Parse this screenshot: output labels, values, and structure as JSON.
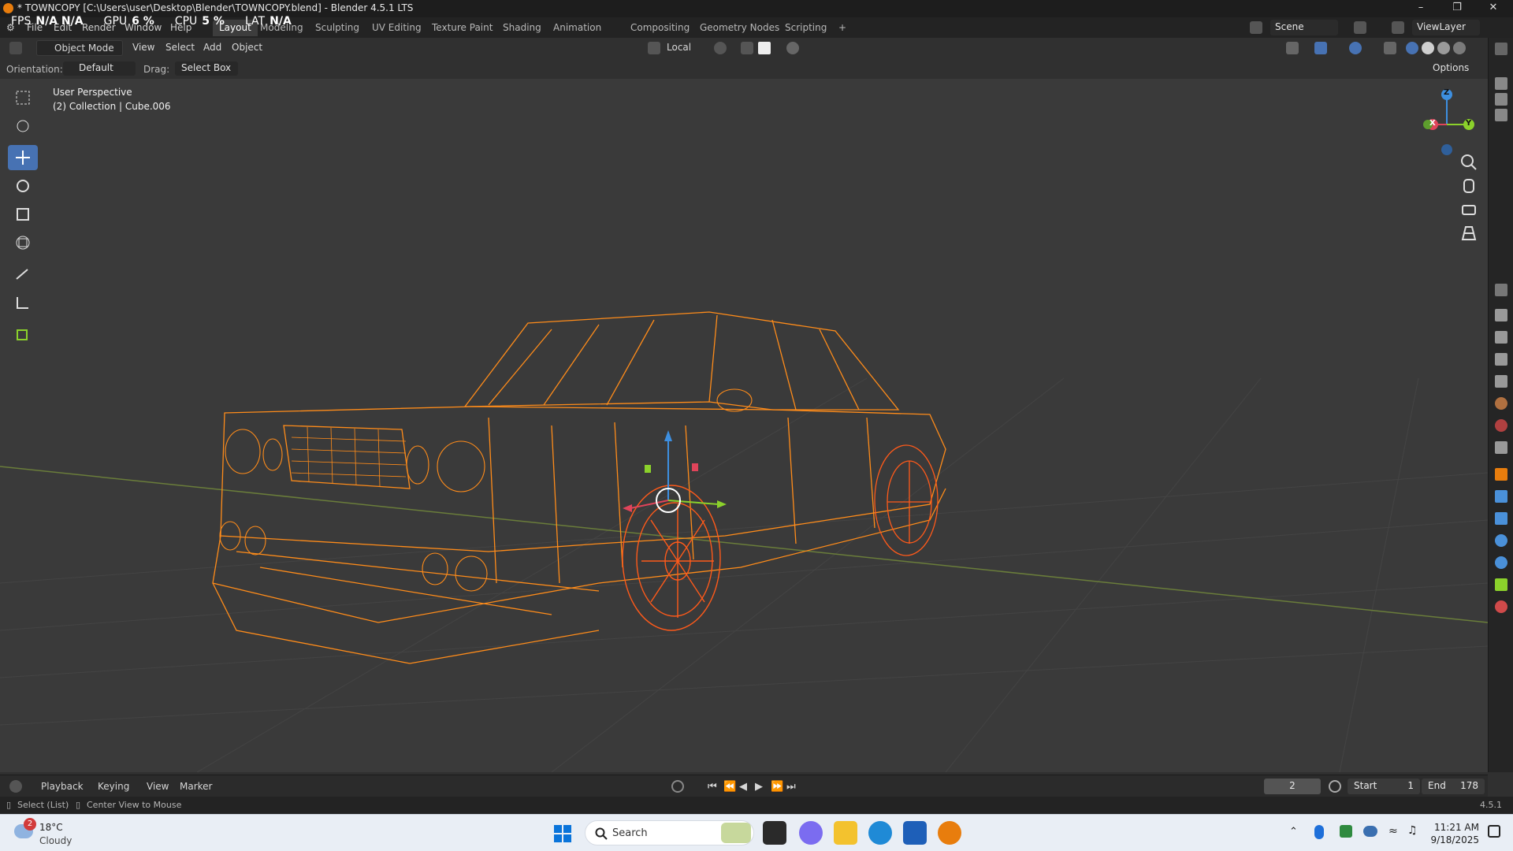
{
  "window": {
    "title": "* TOWNCOPY [C:\\Users\\user\\Desktop\\Blender\\TOWNCOPY.blend] - Blender 4.5.1 LTS"
  },
  "stats": [
    {
      "key": "FPS",
      "value": "N/A N/A"
    },
    {
      "key": "GPU",
      "value": "6 %"
    },
    {
      "key": "CPU",
      "value": "5 %"
    },
    {
      "key": "LAT",
      "value": "N/A"
    }
  ],
  "menu": [
    "File",
    "Edit",
    "Render",
    "Window",
    "Help"
  ],
  "workspaces": {
    "active": "Layout",
    "tabs": [
      "Layout",
      "Modeling",
      "Sculpting",
      "UV Editing",
      "Texture Paint",
      "Shading",
      "Animation",
      "Compositing",
      "Geometry Nodes",
      "Scripting"
    ],
    "add": "+"
  },
  "scene": {
    "name": "Scene",
    "view_layer": "ViewLayer"
  },
  "header": {
    "mode": "Object Mode",
    "menus": [
      "View",
      "Select",
      "Add",
      "Object"
    ],
    "transform_orientation": "Local",
    "options": "Options"
  },
  "tool_settings": {
    "orientation_label": "Orientation:",
    "orientation_value": "Default",
    "drag_label": "Drag:",
    "drag_value": "Select Box"
  },
  "viewport": {
    "perspective": "User Perspective",
    "context": "(2) Collection | Cube.006",
    "wire_color": "#ff8c1a",
    "active_wire_color": "#ff5a1a",
    "gizmo_axes": {
      "x": "X",
      "y": "Y",
      "z": "Z"
    }
  },
  "timeline": {
    "menus": [
      "Playback",
      "Keying",
      "View",
      "Marker"
    ],
    "current_frame": "2",
    "start_label": "Start",
    "start": "1",
    "end_label": "End",
    "end": "178"
  },
  "status": {
    "left_action": "Select (List)",
    "middle_action": "Center View to Mouse",
    "version": "4.5.1"
  },
  "taskbar": {
    "weather_temp": "18°C",
    "weather_cond": "Cloudy",
    "weather_badge": "2",
    "search": "Search",
    "time": "11:21 AM",
    "date": "9/18/2025"
  },
  "colors": {
    "active_tool": "#4772b3",
    "axis_x": "#e0445a",
    "axis_y": "#8bd12b",
    "axis_z": "#3d8fe0"
  }
}
